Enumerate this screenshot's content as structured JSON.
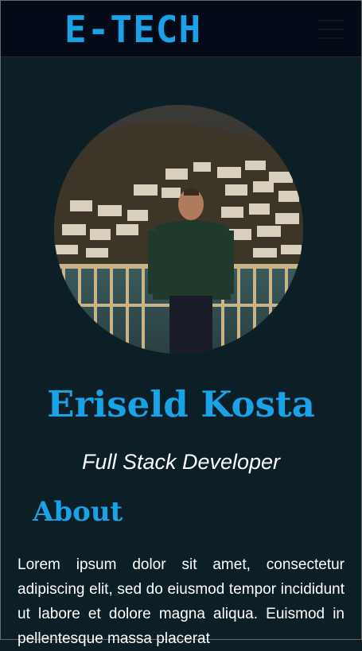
{
  "header": {
    "logo": "E-TECH",
    "menu_icon": "hamburger-menu-icon"
  },
  "profile": {
    "name": "Eriseld Kosta",
    "role": "Full Stack Developer"
  },
  "about": {
    "heading": "About",
    "text": "Lorem ipsum dolor sit amet, consectetur adipiscing elit, sed do eiusmod tempor incididunt ut labore et dolore magna aliqua. Euismod in pellentesque massa placerat"
  },
  "colors": {
    "accent": "#1aa2e6",
    "background": "#0d1f26",
    "navbar": "#050a18",
    "text": "#ffffff"
  }
}
